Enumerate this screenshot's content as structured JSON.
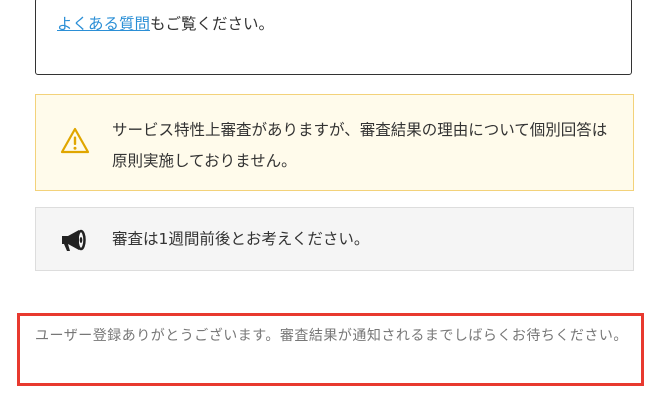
{
  "faq_box": {
    "link_text": "よくある質問",
    "suffix_text": "もご覧ください。"
  },
  "warning": {
    "icon": "warning-triangle-icon",
    "text": "サービス特性上審査がありますが、審査結果の理由について個別回答は原則実施しておりません。"
  },
  "info": {
    "icon": "megaphone-icon",
    "text": "審査は1週間前後とお考えください。"
  },
  "notice": {
    "text": "ユーザー登録ありがとうございます。審査結果が通知されるまでしばらくお待ちください。"
  },
  "colors": {
    "link": "#2b8fd6",
    "warning_bg": "#fffbeb",
    "warning_border": "#f3d27a",
    "warning_icon": "#e0a600",
    "notice_border": "#e8392f"
  }
}
